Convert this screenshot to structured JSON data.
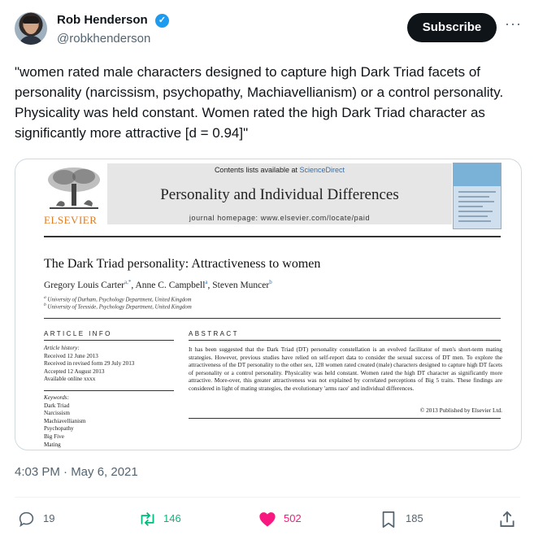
{
  "author": {
    "name": "Rob Henderson",
    "handle": "@robkhenderson"
  },
  "header": {
    "subscribe_label": "Subscribe",
    "more_label": "···"
  },
  "tweet": {
    "text": "\"women rated male characters designed to capture high Dark Triad facets of personality (narcissism, psychopathy, Machiavellianism) or a control personality. Physicality was held constant. Women rated the high Dark Triad character as significantly more attractive [d = 0.94]\"",
    "timestamp": "4:03 PM · May 6, 2021"
  },
  "paper": {
    "publisher_logo": "ELSEVIER",
    "contents_prefix": "Contents lists available at",
    "contents_link": "ScienceDirect",
    "journal": "Personality and Individual Differences",
    "homepage": "journal homepage: www.elsevier.com/locate/paid",
    "title": "The Dark Triad personality: Attractiveness to women",
    "authors": [
      {
        "name": "Gregory Louis Carter",
        "sup": "a,*",
        "sep": ", "
      },
      {
        "name": "Anne C. Campbell",
        "sup": "a",
        "sep": ", "
      },
      {
        "name": "Steven Muncer",
        "sup": "b",
        "sep": ""
      }
    ],
    "affiliations": [
      {
        "sup": "a",
        "text": "University of Durham, Psychology Department, United Kingdom"
      },
      {
        "sup": "b",
        "text": "University of Teesside, Psychology Department, United Kingdom"
      }
    ],
    "article_info_heading": "ARTICLE INFO",
    "history_label": "Article history:",
    "history": [
      "Received 12 June 2013",
      "Received in revised form 29 July 2013",
      "Accepted 12 August 2013",
      "Available online xxxx"
    ],
    "keywords_label": "Keywords:",
    "keywords": [
      "Dark Triad",
      "Narcissism",
      "Machiavellianism",
      "Psychopathy",
      "Big Five",
      "Mating"
    ],
    "abstract_heading": "ABSTRACT",
    "abstract": "It has been suggested that the Dark Triad (DT) personality constellation is an evolved facilitator of men's short-term mating strategies. However, previous studies have relied on self-report data to consider the sexual success of DT men. To explore the attractiveness of the DT personality to the other sex, 128 women rated created (male) characters designed to capture high DT facets of personality or a control personality. Physicality was held constant. Women rated the high DT character as significantly more attractive. More-over, this greater attractiveness was not explained by correlated perceptions of Big 5 traits. These findings are considered in light of mating strategies, the evolutionary 'arms race' and individual differences.",
    "copyright": "© 2013 Published by Elsevier Ltd."
  },
  "actions": {
    "replies": "19",
    "retweets": "146",
    "likes": "502",
    "bookmarks": "185"
  },
  "colors": {
    "retweet": "#00ba7c",
    "like": "#f91880",
    "muted": "#536471",
    "verified": "#1d9bf0"
  }
}
